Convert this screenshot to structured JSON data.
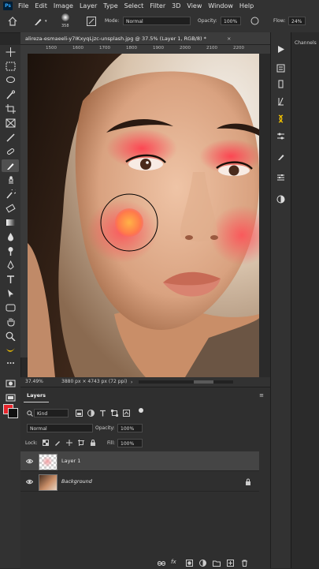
{
  "menu": {
    "logo": "Ps",
    "items": [
      "File",
      "Edit",
      "Image",
      "Layer",
      "Type",
      "Select",
      "Filter",
      "3D",
      "View",
      "Window",
      "Help"
    ]
  },
  "options": {
    "brush_size": "358",
    "mode_label": "Mode:",
    "mode_value": "Normal",
    "opacity_label": "Opacity:",
    "opacity_value": "100%",
    "flow_label": "Flow:",
    "flow_value": "24%"
  },
  "document": {
    "tab_title": "alireza-esmaeeli-y7IKxyqLjzc-unsplash.jpg @ 37.5% (Layer 1, RGB/8) *",
    "close": "×"
  },
  "ruler_ticks": [
    "1500",
    "1600",
    "1700",
    "1800",
    "1900",
    "2000",
    "2100",
    "2200"
  ],
  "status": {
    "zoom": "37.49%",
    "info": "3880 px × 4743 px (72 ppi)"
  },
  "right_panel": {
    "tab": "Channels"
  },
  "layers": {
    "tab": "Layers",
    "filter_kind": "Kind",
    "blend_mode": "Normal",
    "opacity_label": "Opacity:",
    "opacity_value": "100%",
    "lock_label": "Lock:",
    "fill_label": "Fill:",
    "fill_value": "100%",
    "rows": [
      {
        "name": "Layer 1"
      },
      {
        "name": "Background"
      }
    ],
    "bottom_fx": "fx"
  },
  "colors": {
    "foreground": "#e8252c",
    "background": "#111111",
    "accent_panel": "#323232"
  }
}
